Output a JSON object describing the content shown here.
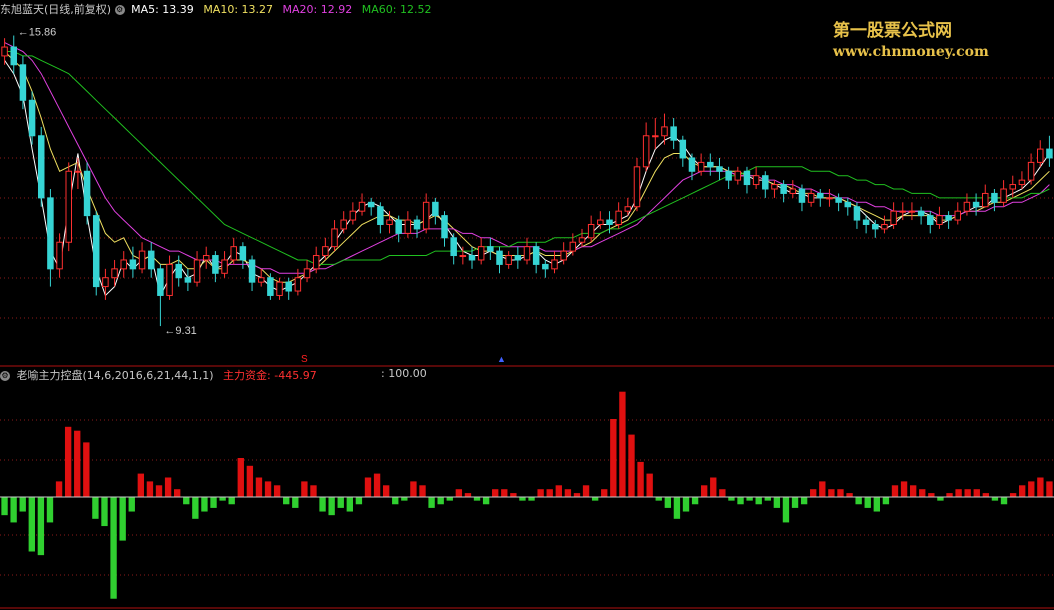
{
  "header": {
    "stock_title": "东旭蓝天(日线,前复权)",
    "ma5": "MA5: 13.39",
    "ma10": "MA10: 13.27",
    "ma20": "MA20: 12.92",
    "ma60": "MA60: 12.52"
  },
  "sub_header": {
    "indicator_name": "老喻主力控盘(14,6,2016,6,21,44,1,1)",
    "fund_label": "主力资金: -445.97",
    "ref_level": ": 100.00"
  },
  "watermark": {
    "line1": "第一股票公式网",
    "line2": "www.chnmoney.com"
  },
  "colors": {
    "background": "#000000",
    "up": "#ff3030",
    "down": "#36d4d4",
    "ma5": "#ffffff",
    "ma10": "#f0e060",
    "ma20": "#e040e0",
    "ma60": "#20c020",
    "hist_pos": "#e01010",
    "hist_neg": "#30d030",
    "grid": "#8b1a1a",
    "watermark": "#e8c24a"
  },
  "chart_data": [
    {
      "type": "candlestick",
      "title": "东旭蓝天(日线,前复权)",
      "ylim": [
        8.5,
        16.3
      ],
      "grid": "horizontal dotted",
      "annotations": [
        {
          "text": "15.86",
          "index": 1,
          "value": 15.86
        },
        {
          "text": "9.31",
          "index": 17,
          "value": 9.31
        }
      ],
      "series": [
        {
          "name": "MA5",
          "values": [
            15.3,
            15.0,
            14.5,
            13.3,
            12.2,
            11.0,
            10.6,
            12.0,
            13.2,
            11.8,
            10.6,
            10.0,
            10.2,
            10.8,
            10.6,
            10.8,
            10.9,
            10.0,
            10.4,
            10.7,
            10.4,
            10.5,
            10.9,
            10.6,
            10.7,
            11.0,
            10.9,
            10.5,
            10.4,
            10.2,
            10.1,
            10.2,
            10.3,
            10.5,
            10.7,
            10.9,
            11.2,
            11.5,
            11.8,
            12.0,
            12.1,
            12.0,
            11.8,
            11.6,
            11.6,
            11.6,
            11.7,
            11.9,
            11.6,
            11.3,
            11.0,
            10.9,
            10.9,
            11.0,
            10.9,
            10.8,
            10.8,
            10.9,
            11.0,
            10.8,
            10.7,
            10.8,
            11.0,
            11.2,
            11.4,
            11.6,
            11.6,
            11.7,
            11.8,
            12.2,
            12.8,
            13.3,
            13.5,
            13.6,
            13.4,
            13.1,
            12.9,
            12.9,
            12.9,
            12.8,
            12.7,
            12.7,
            12.6,
            12.6,
            12.5,
            12.4,
            12.3,
            12.3,
            12.2,
            12.2,
            12.2,
            12.2,
            12.1,
            12.0,
            11.8,
            11.6,
            11.5,
            11.6,
            11.8,
            11.9,
            11.9,
            11.8,
            11.6,
            11.7,
            11.8,
            11.9,
            12.0,
            12.0,
            12.2,
            12.2,
            12.3,
            12.4,
            12.6,
            12.9,
            13.2
          ]
        },
        {
          "name": "MA10",
          "values": [
            15.5,
            15.3,
            15.1,
            14.6,
            14.0,
            13.3,
            12.8,
            12.9,
            13.0,
            12.4,
            11.9,
            11.4,
            11.2,
            11.3,
            10.9,
            10.8,
            10.9,
            10.7,
            10.7,
            10.8,
            10.6,
            10.6,
            10.8,
            10.6,
            10.6,
            10.8,
            10.8,
            10.7,
            10.6,
            10.4,
            10.3,
            10.3,
            10.4,
            10.5,
            10.6,
            10.8,
            11.0,
            11.2,
            11.4,
            11.6,
            11.7,
            11.8,
            11.8,
            11.7,
            11.7,
            11.6,
            11.7,
            11.8,
            11.7,
            11.5,
            11.3,
            11.1,
            11.0,
            11.0,
            10.9,
            10.9,
            10.9,
            10.9,
            11.0,
            10.9,
            10.9,
            10.9,
            11.0,
            11.1,
            11.2,
            11.4,
            11.5,
            11.6,
            11.7,
            12.0,
            12.4,
            12.8,
            13.1,
            13.2,
            13.2,
            13.0,
            12.9,
            12.9,
            12.9,
            12.8,
            12.8,
            12.7,
            12.7,
            12.6,
            12.5,
            12.5,
            12.4,
            12.3,
            12.3,
            12.2,
            12.2,
            12.2,
            12.1,
            12.0,
            11.9,
            11.8,
            11.7,
            11.7,
            11.8,
            11.8,
            11.8,
            11.8,
            11.7,
            11.7,
            11.8,
            11.9,
            11.9,
            12.0,
            12.1,
            12.1,
            12.2,
            12.3,
            12.4,
            12.6,
            12.8
          ]
        },
        {
          "name": "MA20",
          "values": [
            15.7,
            15.6,
            15.5,
            15.3,
            15.0,
            14.6,
            14.2,
            13.8,
            13.4,
            13.0,
            12.6,
            12.2,
            11.9,
            11.7,
            11.5,
            11.3,
            11.2,
            11.1,
            11.0,
            11.0,
            10.9,
            10.8,
            10.8,
            10.8,
            10.7,
            10.7,
            10.7,
            10.7,
            10.6,
            10.6,
            10.5,
            10.5,
            10.5,
            10.5,
            10.6,
            10.6,
            10.7,
            10.8,
            10.9,
            11.0,
            11.1,
            11.2,
            11.3,
            11.4,
            11.4,
            11.4,
            11.5,
            11.5,
            11.5,
            11.5,
            11.4,
            11.4,
            11.3,
            11.3,
            11.2,
            11.1,
            11.1,
            11.1,
            11.1,
            11.0,
            11.0,
            11.0,
            11.0,
            11.1,
            11.1,
            11.2,
            11.3,
            11.4,
            11.5,
            11.6,
            11.8,
            12.0,
            12.2,
            12.4,
            12.6,
            12.7,
            12.8,
            12.8,
            12.8,
            12.8,
            12.7,
            12.7,
            12.7,
            12.6,
            12.6,
            12.5,
            12.5,
            12.4,
            12.4,
            12.3,
            12.3,
            12.2,
            12.2,
            12.1,
            12.1,
            12.0,
            12.0,
            11.9,
            11.9,
            11.9,
            11.9,
            11.9,
            11.8,
            11.8,
            11.8,
            11.9,
            11.9,
            11.9,
            12.0,
            12.0,
            12.1,
            12.1,
            12.2,
            12.3,
            12.5
          ]
        },
        {
          "name": "MA60",
          "values": [
            15.5,
            15.5,
            15.4,
            15.4,
            15.3,
            15.2,
            15.1,
            15.0,
            14.8,
            14.6,
            14.4,
            14.2,
            14.0,
            13.8,
            13.6,
            13.4,
            13.2,
            13.0,
            12.8,
            12.6,
            12.4,
            12.2,
            12.0,
            11.8,
            11.6,
            11.5,
            11.4,
            11.3,
            11.2,
            11.1,
            11.0,
            10.9,
            10.8,
            10.8,
            10.7,
            10.7,
            10.7,
            10.8,
            10.8,
            10.8,
            10.8,
            10.8,
            10.9,
            10.9,
            10.9,
            10.9,
            10.9,
            11.0,
            11.0,
            11.0,
            11.0,
            11.0,
            11.1,
            11.1,
            11.1,
            11.1,
            11.2,
            11.2,
            11.2,
            11.2,
            11.3,
            11.3,
            11.3,
            11.4,
            11.4,
            11.4,
            11.5,
            11.5,
            11.6,
            11.7,
            11.8,
            11.9,
            12.0,
            12.1,
            12.2,
            12.3,
            12.4,
            12.5,
            12.6,
            12.7,
            12.7,
            12.8,
            12.9,
            12.9,
            12.9,
            12.9,
            12.9,
            12.9,
            12.8,
            12.8,
            12.8,
            12.7,
            12.7,
            12.6,
            12.6,
            12.5,
            12.5,
            12.4,
            12.4,
            12.3,
            12.3,
            12.3,
            12.2,
            12.2,
            12.2,
            12.2,
            12.2,
            12.2,
            12.2,
            12.2,
            12.2,
            12.2,
            12.3,
            12.3,
            12.4
          ]
        }
      ],
      "candles": {
        "open": [
          15.4,
          15.6,
          15.2,
          14.4,
          13.6,
          12.2,
          10.6,
          11.2,
          12.8,
          12.8,
          11.8,
          10.2,
          10.4,
          10.6,
          10.8,
          10.6,
          11.0,
          10.6,
          10.0,
          10.7,
          10.4,
          10.3,
          10.8,
          10.9,
          10.5,
          10.8,
          11.1,
          10.8,
          10.3,
          10.4,
          10.0,
          10.3,
          10.1,
          10.4,
          10.6,
          10.9,
          11.1,
          11.5,
          11.7,
          11.9,
          12.1,
          12.0,
          11.6,
          11.7,
          11.4,
          11.7,
          11.5,
          12.1,
          11.8,
          11.3,
          10.9,
          10.9,
          10.8,
          11.1,
          11.0,
          10.7,
          10.9,
          10.8,
          11.1,
          10.7,
          10.6,
          10.8,
          11.0,
          11.2,
          11.3,
          11.6,
          11.7,
          11.6,
          11.9,
          12.0,
          12.9,
          13.6,
          13.6,
          13.8,
          13.5,
          13.1,
          12.8,
          13.0,
          12.9,
          12.8,
          12.6,
          12.8,
          12.5,
          12.7,
          12.4,
          12.5,
          12.3,
          12.4,
          12.1,
          12.3,
          12.2,
          12.2,
          12.1,
          12.0,
          11.7,
          11.6,
          11.5,
          11.6,
          11.9,
          11.9,
          11.9,
          11.8,
          11.6,
          11.8,
          11.7,
          11.9,
          12.1,
          12.0,
          12.3,
          12.1,
          12.4,
          12.5,
          12.6,
          13.0,
          13.3
        ],
        "close": [
          15.6,
          15.2,
          14.4,
          13.6,
          12.2,
          10.6,
          11.2,
          12.8,
          12.8,
          11.8,
          10.2,
          10.4,
          10.6,
          10.8,
          10.6,
          11.0,
          10.6,
          10.0,
          10.7,
          10.4,
          10.3,
          10.8,
          10.9,
          10.5,
          10.8,
          11.1,
          10.8,
          10.3,
          10.4,
          10.0,
          10.3,
          10.1,
          10.4,
          10.6,
          10.9,
          11.1,
          11.5,
          11.7,
          11.9,
          12.1,
          12.0,
          11.6,
          11.7,
          11.4,
          11.7,
          11.5,
          12.1,
          11.8,
          11.3,
          10.9,
          10.9,
          10.8,
          11.1,
          11.0,
          10.7,
          10.9,
          10.8,
          11.1,
          10.7,
          10.6,
          10.8,
          11.0,
          11.2,
          11.3,
          11.6,
          11.7,
          11.6,
          11.9,
          12.0,
          12.9,
          13.6,
          13.6,
          13.8,
          13.5,
          13.1,
          12.8,
          13.0,
          12.9,
          12.8,
          12.6,
          12.8,
          12.5,
          12.7,
          12.4,
          12.5,
          12.3,
          12.4,
          12.1,
          12.3,
          12.2,
          12.2,
          12.1,
          12.0,
          11.7,
          11.6,
          11.5,
          11.6,
          11.9,
          11.9,
          11.9,
          11.8,
          11.6,
          11.8,
          11.7,
          11.9,
          12.1,
          12.0,
          12.3,
          12.1,
          12.4,
          12.5,
          12.6,
          13.0,
          13.3,
          13.1
        ],
        "high": [
          15.8,
          15.86,
          15.4,
          14.6,
          13.8,
          12.4,
          11.4,
          13.0,
          13.1,
          13.0,
          11.9,
          10.6,
          10.8,
          11.0,
          11.1,
          11.2,
          11.2,
          10.7,
          10.9,
          10.9,
          10.6,
          11.0,
          11.1,
          11.0,
          11.0,
          11.3,
          11.2,
          10.9,
          10.6,
          10.5,
          10.4,
          10.4,
          10.6,
          10.8,
          11.1,
          11.3,
          11.7,
          11.9,
          12.1,
          12.3,
          12.2,
          12.1,
          11.9,
          11.8,
          11.9,
          11.8,
          12.3,
          12.2,
          11.9,
          11.4,
          11.1,
          11.1,
          11.3,
          11.3,
          11.1,
          11.0,
          11.1,
          11.3,
          11.2,
          10.8,
          11.0,
          11.2,
          11.4,
          11.5,
          11.8,
          11.9,
          11.9,
          12.1,
          12.2,
          13.1,
          13.9,
          14.0,
          14.1,
          14.0,
          13.6,
          13.2,
          13.2,
          13.2,
          13.1,
          12.9,
          12.9,
          12.9,
          12.9,
          12.8,
          12.6,
          12.6,
          12.6,
          12.5,
          12.4,
          12.4,
          12.4,
          12.3,
          12.2,
          12.1,
          11.8,
          11.7,
          11.8,
          12.1,
          12.1,
          12.1,
          12.0,
          11.9,
          12.0,
          11.9,
          12.1,
          12.3,
          12.3,
          12.5,
          12.4,
          12.6,
          12.7,
          12.8,
          13.2,
          13.5,
          13.6
        ],
        "low": [
          15.2,
          15.0,
          14.2,
          13.4,
          12.0,
          10.2,
          10.4,
          11.0,
          12.4,
          11.6,
          10.0,
          9.9,
          10.2,
          10.4,
          10.4,
          10.5,
          10.4,
          9.31,
          9.9,
          10.2,
          10.1,
          10.2,
          10.6,
          10.3,
          10.4,
          10.7,
          10.6,
          10.1,
          10.2,
          9.9,
          9.9,
          9.9,
          10.0,
          10.3,
          10.5,
          10.8,
          11.0,
          11.4,
          11.6,
          11.8,
          11.8,
          11.4,
          11.4,
          11.2,
          11.3,
          11.3,
          11.4,
          11.6,
          11.1,
          10.7,
          10.7,
          10.6,
          10.7,
          10.8,
          10.5,
          10.6,
          10.6,
          10.7,
          10.5,
          10.4,
          10.5,
          10.7,
          10.9,
          11.1,
          11.2,
          11.5,
          11.4,
          11.5,
          11.8,
          11.9,
          12.8,
          13.3,
          13.4,
          13.3,
          12.9,
          12.6,
          12.7,
          12.7,
          12.6,
          12.4,
          12.5,
          12.3,
          12.4,
          12.2,
          12.2,
          12.1,
          12.2,
          11.9,
          12.0,
          12.0,
          12.0,
          11.9,
          11.8,
          11.5,
          11.4,
          11.3,
          11.4,
          11.5,
          11.7,
          11.7,
          11.6,
          11.4,
          11.5,
          11.5,
          11.6,
          11.8,
          11.8,
          12.0,
          11.9,
          12.0,
          12.2,
          12.4,
          12.5,
          12.9,
          12.9
        ]
      }
    },
    {
      "type": "bar",
      "title": "老喻主力控盘(14,6,2016,6,21,44,1,1)",
      "ylim": [
        -300,
        300
      ],
      "reference_line": 0,
      "series": [
        {
          "name": "主力资金",
          "values": [
            -50,
            -70,
            -40,
            -150,
            -160,
            -70,
            40,
            180,
            170,
            140,
            -60,
            -80,
            -280,
            -120,
            -40,
            60,
            40,
            30,
            50,
            20,
            -20,
            -60,
            -40,
            -30,
            -10,
            -20,
            100,
            80,
            50,
            40,
            30,
            -20,
            -30,
            40,
            30,
            -40,
            -50,
            -30,
            -40,
            -20,
            50,
            60,
            30,
            -20,
            -10,
            40,
            30,
            -30,
            -20,
            -10,
            20,
            10,
            -10,
            -20,
            20,
            20,
            10,
            -10,
            -10,
            20,
            20,
            30,
            20,
            10,
            30,
            -10,
            20,
            200,
            270,
            160,
            90,
            60,
            -10,
            -30,
            -60,
            -40,
            -20,
            30,
            50,
            20,
            -10,
            -20,
            -10,
            -20,
            -10,
            -30,
            -70,
            -30,
            -20,
            20,
            40,
            20,
            20,
            10,
            -20,
            -30,
            -40,
            -20,
            30,
            40,
            30,
            20,
            10,
            -10,
            10,
            20,
            20,
            20,
            10,
            -10,
            -20,
            10,
            30,
            40,
            50,
            40
          ]
        }
      ]
    }
  ]
}
